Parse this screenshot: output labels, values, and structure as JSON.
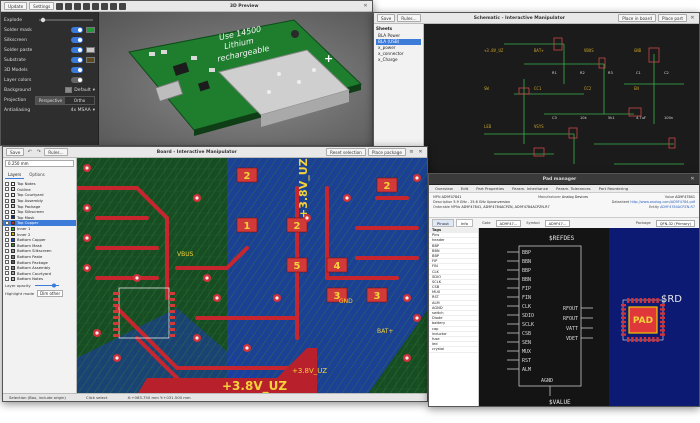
{
  "preview3d": {
    "tabs": [
      "Update",
      "Settings"
    ],
    "title": "3D Preview",
    "labels": {
      "explode": "Explode",
      "solder_mask": "Solder mask",
      "silkscreen": "Silkscreen",
      "solder_paste": "Solder paste",
      "substrate": "Substrate",
      "models": "3D Models",
      "layer_colors": "Layer colors",
      "background": "Background",
      "background_value": "Default",
      "projection": "Projection",
      "perspective": "Perspective",
      "ortho": "Ortho",
      "antialiasing": "Antialiasing",
      "antialiasing_value": "4x MSAA"
    },
    "board_text": [
      "Use 14500",
      "Lithium",
      "rechargeable"
    ],
    "colors": {
      "solder_mask": "#1f9a36",
      "substrate": "#5a4a1a"
    }
  },
  "schematic": {
    "title": "Schematic - Interactive Manipulator",
    "buttons": [
      "Save",
      "Rules...",
      "Place in board",
      "Place part"
    ],
    "sheets_header": "Sheets",
    "sheets": [
      "BLA Power",
      "BLA (USB)",
      "x_power",
      "x_connector",
      "x_Charge"
    ],
    "selected_sheet": 1,
    "net_labels": [
      "+3.8V_UZ",
      "BAT+",
      "VBUS",
      "GND",
      "SW",
      "CC1",
      "CC2",
      "EN",
      "LED",
      "VSYS"
    ],
    "passives": [
      "R1",
      "R2",
      "R3",
      "C1",
      "C2",
      "C3",
      "10k",
      "5k1",
      "4.7uF",
      "100n"
    ]
  },
  "board": {
    "title": "Board - Interactive Manipulator",
    "buttons": [
      "Save",
      "Rules...",
      "Reset selection",
      "Place package"
    ],
    "layers_tabs": [
      "Layers",
      "Options"
    ],
    "width_value": "0.250 mm",
    "layers": [
      {
        "name": "Top Notes",
        "color": "#ffffff"
      },
      {
        "name": "Outline",
        "color": "#d7d7d7"
      },
      {
        "name": "Top Courtyard",
        "color": "#eeeeee"
      },
      {
        "name": "Top Assembly",
        "color": "#b0b0b0"
      },
      {
        "name": "Top Package",
        "color": "#c8c8c8"
      },
      {
        "name": "Top Silkscreen",
        "color": "#f2f2f2"
      },
      {
        "name": "Top Mask",
        "color": "#0d2c7a"
      },
      {
        "name": "Top Copper",
        "color": "#c0262e"
      },
      {
        "name": "Inner 1",
        "color": "#2aa22a"
      },
      {
        "name": "Inner 2",
        "color": "#c7b000"
      },
      {
        "name": "Bottom Copper",
        "color": "#1a49d1"
      },
      {
        "name": "Bottom Mask",
        "color": "#40813c"
      },
      {
        "name": "Bottom Silkscreen",
        "color": "#9d9d9d"
      },
      {
        "name": "Bottom Paste",
        "color": "#7a7a7a"
      },
      {
        "name": "Bottom Package",
        "color": "#5c5c5c"
      },
      {
        "name": "Bottom Assembly",
        "color": "#888888"
      },
      {
        "name": "Bottom Courtyard",
        "color": "#a5a5a5"
      },
      {
        "name": "Bottom Notes",
        "color": "#bbbbbb"
      }
    ],
    "selected_layer": 7,
    "layer_opacity_label": "Layer opacity",
    "highlight_mode_label": "Highlight mode",
    "highlight_mode_value": "Dim other",
    "pad_numbers": [
      "2",
      "1",
      "2",
      "5",
      "4",
      "3",
      "3",
      "2"
    ],
    "net_labels": [
      "+3.8V_UZ",
      "+3.8V_UZ",
      "+3.8V_UZ",
      "GND",
      "VBUS",
      "BAT+"
    ],
    "status": [
      "Selection (Box, include origin)",
      "Click select",
      "X:+063.750 mm Y:+031.500 mm"
    ]
  },
  "pad_manager": {
    "title": "Pad manager",
    "tabs": [
      "Overview",
      "Edit",
      "Part Properties",
      "Param. Inheritance",
      "Param. Tolerances",
      "Part Reordering"
    ],
    "meta": {
      "mpn_label": "MPN",
      "mpn": "AD9F47841",
      "manufacturer_label": "Manufacturer",
      "manufacturer": "Analog Devices",
      "value_label": "Value",
      "value": "AD9F47841",
      "description_label": "Description",
      "description": "5.9 GHz - 25.6 GHz Upconversion",
      "datasheet_label": "Datasheet",
      "datasheet": "http://www.analog.com/AD9F4784.pdf",
      "orderable_label": "Orderable MPNs",
      "orderable": "AD9F47841, AD9F4784ACPZN, AD9F4784ACPZN-R7",
      "entity_label": "Entity",
      "entity": "AD9F4784ACPZN-R7"
    },
    "subtabs": [
      "Pinout",
      "Info"
    ],
    "gate_label": "Gate",
    "gate_value": "AD9F47...",
    "symbol_label": "Symbol",
    "symbol_value": "AD9F47...",
    "package_label": "Package",
    "package_value": "QFN-32 (Primary)",
    "list_header": "Tags",
    "list": [
      "Pins",
      "header",
      "BBP",
      "BBN",
      "BBP",
      "FIP",
      "FIN",
      "CLK",
      "SDIO",
      "SCLK",
      "CSB",
      "MUX",
      "RST",
      "ALM",
      "AGND",
      "switch",
      "Diode",
      "battery",
      "cap",
      "inductor",
      "fuse",
      "led",
      "crystal"
    ],
    "symbol_pins_left": [
      "BBP",
      "BBN",
      "BBP",
      "BBN",
      "FIP",
      "FIN",
      "CLK",
      "SDIO",
      "SCLK",
      "CSB",
      "SEN",
      "MUX",
      "RST",
      "ALM"
    ],
    "symbol_pins_right": [
      "RFOUT",
      "RFOUT",
      "VATT",
      "VDET"
    ],
    "symbol_text": [
      "$REFDES",
      "$VALUE",
      "AGND"
    ],
    "pad_label": "PAD",
    "refdes_label": "$RD"
  }
}
